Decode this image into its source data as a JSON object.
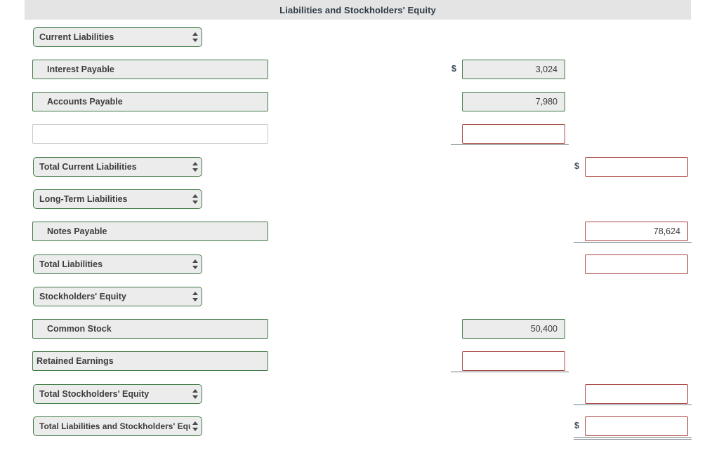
{
  "header": {
    "title": "Liabilities and Stockholders' Equity"
  },
  "currency_symbol": "$",
  "rows": [
    {
      "kind": "select",
      "name": "section-current-liabilities",
      "label": "Current Liabilities"
    },
    {
      "kind": "line",
      "name": "interest-payable",
      "label": "Interest Payable",
      "dollar": "$",
      "mid_value": "3,024"
    },
    {
      "kind": "line",
      "name": "accounts-payable",
      "label": "Accounts Payable",
      "mid_value": "7,980"
    },
    {
      "kind": "line",
      "name": "blank-entry",
      "label": "",
      "mid_value": ""
    },
    {
      "kind": "select",
      "name": "total-current-liabilities",
      "label": "Total Current Liabilities",
      "dollar": "$",
      "right_value": ""
    },
    {
      "kind": "select",
      "name": "section-long-term-liabilities",
      "label": "Long-Term Liabilities"
    },
    {
      "kind": "line",
      "name": "notes-payable",
      "label": "Notes Payable",
      "right_value": "78,624"
    },
    {
      "kind": "select",
      "name": "total-liabilities",
      "label": "Total Liabilities",
      "right_value": ""
    },
    {
      "kind": "select",
      "name": "section-stockholders-equity",
      "label": "Stockholders' Equity"
    },
    {
      "kind": "line",
      "name": "common-stock",
      "label": "Common Stock",
      "mid_value": "50,400"
    },
    {
      "kind": "line",
      "name": "retained-earnings",
      "label": "Retained Earnings",
      "mid_value": ""
    },
    {
      "kind": "select",
      "name": "total-stockholders-equity",
      "label": "Total Stockholders' Equity",
      "right_value": ""
    },
    {
      "kind": "select",
      "name": "total-liabilities-and-stockholders-equity",
      "label": "Total Liabilities and Stockholders' Equity",
      "dollar": "$",
      "right_value": ""
    }
  ],
  "colors": {
    "header_band": "#e4e4e4",
    "valid_border": "#3f7a45",
    "invalid_border": "#a94442",
    "field_fill": "#ececec",
    "rule": "#6d7880",
    "text": "#3d3d3d"
  }
}
